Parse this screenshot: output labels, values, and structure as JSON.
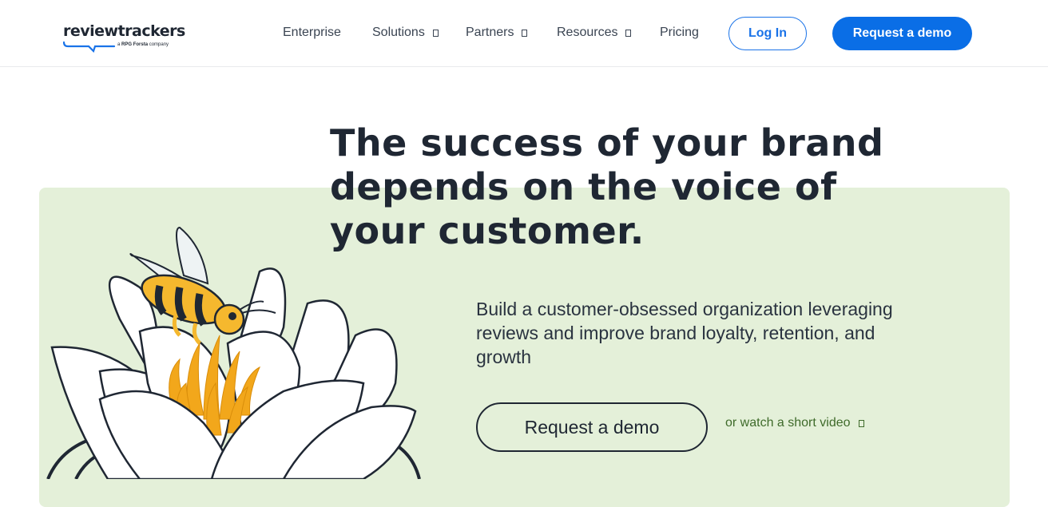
{
  "brand": {
    "name": "reviewtrackers",
    "tagline": "a ",
    "parent_prefix": "RPG",
    "parent_name": "Forsta",
    "parent_suffix": " company"
  },
  "nav": {
    "items": [
      {
        "label": "Enterprise",
        "has_dropdown": false
      },
      {
        "label": "Solutions",
        "has_dropdown": true
      },
      {
        "label": "Partners",
        "has_dropdown": true
      },
      {
        "label": "Resources",
        "has_dropdown": true
      },
      {
        "label": "Pricing",
        "has_dropdown": false
      }
    ],
    "login_label": "Log In",
    "demo_label": "Request a demo"
  },
  "hero": {
    "headline": "The success of your brand depends on the voice of your customer.",
    "subtext": "Build a customer-obsessed organization leveraging reviews and improve brand loyalty, retention, and growth",
    "cta_label": "Request a demo",
    "video_link_label": "or watch a short video"
  },
  "colors": {
    "primary_blue": "#0a6ee6",
    "hero_background": "#e4f0d9",
    "text_dark": "#1f2733",
    "link_green": "#3f6b2b",
    "bee_yellow": "#f5b82e",
    "stamen_orange": "#f2a71b"
  },
  "icons": {
    "dropdown": "chevron-down-icon",
    "video_link": "chevron-right-icon",
    "illustration": "bee-on-lotus-illustration"
  }
}
